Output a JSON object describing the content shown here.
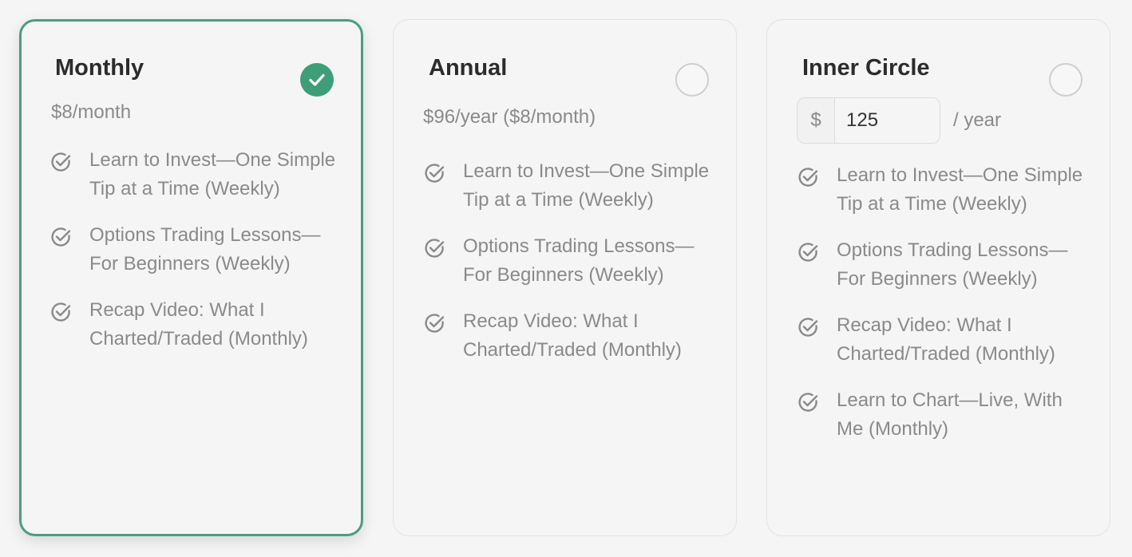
{
  "plans": [
    {
      "title": "Monthly",
      "selected": true,
      "price": "$8/month",
      "features": [
        "Learn to Invest—One Simple Tip at a Time (Weekly)",
        "Options Trading Lessons—For Beginners (Weekly)",
        "Recap Video: What I Charted/Traded (Monthly)"
      ]
    },
    {
      "title": "Annual",
      "selected": false,
      "price": "$96/year ($8/month)",
      "features": [
        "Learn to Invest—One Simple Tip at a Time (Weekly)",
        "Options Trading Lessons—For Beginners (Weekly)",
        "Recap Video: What I Charted/Traded (Monthly)"
      ]
    },
    {
      "title": "Inner Circle",
      "selected": false,
      "currency_symbol": "$",
      "amount_value": "125",
      "period": "/ year",
      "features": [
        "Learn to Invest—One Simple Tip at a Time (Weekly)",
        "Options Trading Lessons—For Beginners (Weekly)",
        "Recap Video: What I Charted/Traded (Monthly)",
        "Learn to Chart—Live, With Me (Monthly)"
      ]
    }
  ],
  "icons": {
    "selected_check": "check-icon",
    "feature": "check-circle-icon"
  },
  "colors": {
    "accent": "#3e9e78",
    "selected_border": "#4a9e7e",
    "text_primary": "#2c2c2c",
    "text_secondary": "#8a8a8a"
  }
}
